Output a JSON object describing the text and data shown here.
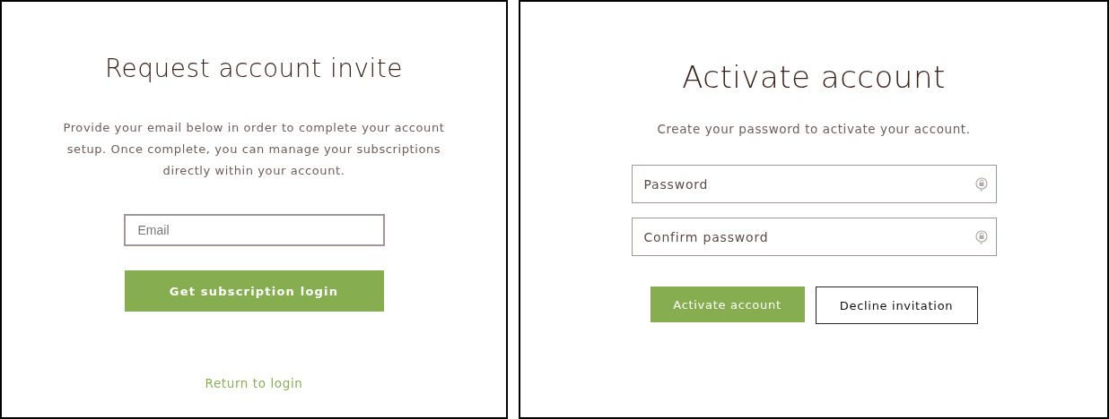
{
  "panels": [
    {
      "title": "Request account invite",
      "description": "Provide your email below in order to complete your account setup. Once complete, you can manage your subscriptions directly within your account.",
      "fields": [
        {
          "placeholder": "Email",
          "kind": "email"
        }
      ],
      "buttons": [
        {
          "label": "Get subscription login",
          "kind": "primary"
        }
      ],
      "link": "Return to login"
    },
    {
      "title": "Activate account",
      "description": "Create your password to activate your account.",
      "fields": [
        {
          "placeholder": "Password",
          "kind": "password"
        },
        {
          "placeholder": "Confirm password",
          "kind": "password"
        }
      ],
      "buttons": [
        {
          "label": "Activate account",
          "kind": "primary"
        },
        {
          "label": "Decline invitation",
          "kind": "secondary"
        }
      ]
    }
  ]
}
